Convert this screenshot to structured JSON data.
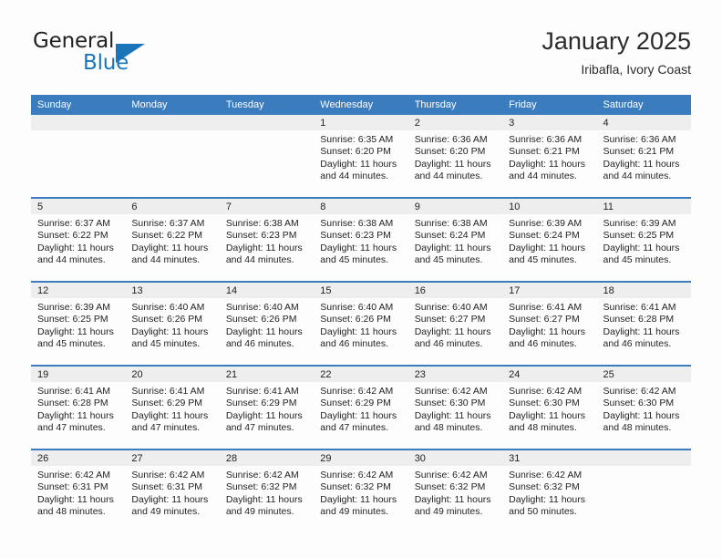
{
  "logo": {
    "word_top": "General",
    "word_bottom": "Blue",
    "triangle": "blue-triangle-icon",
    "color_dark": "#231f20",
    "color_blue": "#1b75bb"
  },
  "header": {
    "title": "January 2025",
    "subtitle": "Iribafla, Ivory Coast"
  },
  "theme": {
    "header_blue": "#3b7cbf",
    "daynum_band": "#eeeeee",
    "page_background": "#fdfdfd"
  },
  "weekday_headers": [
    "Sunday",
    "Monday",
    "Tuesday",
    "Wednesday",
    "Thursday",
    "Friday",
    "Saturday"
  ],
  "labels": {
    "sunrise_prefix": "Sunrise: ",
    "sunset_prefix": "Sunset: ",
    "daylight_prefix": "Daylight: "
  },
  "weeks": [
    [
      {
        "day": "",
        "sunrise": "",
        "sunset": "",
        "daylight_line1": "",
        "daylight_line2": ""
      },
      {
        "day": "",
        "sunrise": "",
        "sunset": "",
        "daylight_line1": "",
        "daylight_line2": ""
      },
      {
        "day": "",
        "sunrise": "",
        "sunset": "",
        "daylight_line1": "",
        "daylight_line2": ""
      },
      {
        "day": "1",
        "sunrise": "Sunrise: 6:35 AM",
        "sunset": "Sunset: 6:20 PM",
        "daylight_line1": "Daylight: 11 hours",
        "daylight_line2": "and 44 minutes."
      },
      {
        "day": "2",
        "sunrise": "Sunrise: 6:36 AM",
        "sunset": "Sunset: 6:20 PM",
        "daylight_line1": "Daylight: 11 hours",
        "daylight_line2": "and 44 minutes."
      },
      {
        "day": "3",
        "sunrise": "Sunrise: 6:36 AM",
        "sunset": "Sunset: 6:21 PM",
        "daylight_line1": "Daylight: 11 hours",
        "daylight_line2": "and 44 minutes."
      },
      {
        "day": "4",
        "sunrise": "Sunrise: 6:36 AM",
        "sunset": "Sunset: 6:21 PM",
        "daylight_line1": "Daylight: 11 hours",
        "daylight_line2": "and 44 minutes."
      }
    ],
    [
      {
        "day": "5",
        "sunrise": "Sunrise: 6:37 AM",
        "sunset": "Sunset: 6:22 PM",
        "daylight_line1": "Daylight: 11 hours",
        "daylight_line2": "and 44 minutes."
      },
      {
        "day": "6",
        "sunrise": "Sunrise: 6:37 AM",
        "sunset": "Sunset: 6:22 PM",
        "daylight_line1": "Daylight: 11 hours",
        "daylight_line2": "and 44 minutes."
      },
      {
        "day": "7",
        "sunrise": "Sunrise: 6:38 AM",
        "sunset": "Sunset: 6:23 PM",
        "daylight_line1": "Daylight: 11 hours",
        "daylight_line2": "and 44 minutes."
      },
      {
        "day": "8",
        "sunrise": "Sunrise: 6:38 AM",
        "sunset": "Sunset: 6:23 PM",
        "daylight_line1": "Daylight: 11 hours",
        "daylight_line2": "and 45 minutes."
      },
      {
        "day": "9",
        "sunrise": "Sunrise: 6:38 AM",
        "sunset": "Sunset: 6:24 PM",
        "daylight_line1": "Daylight: 11 hours",
        "daylight_line2": "and 45 minutes."
      },
      {
        "day": "10",
        "sunrise": "Sunrise: 6:39 AM",
        "sunset": "Sunset: 6:24 PM",
        "daylight_line1": "Daylight: 11 hours",
        "daylight_line2": "and 45 minutes."
      },
      {
        "day": "11",
        "sunrise": "Sunrise: 6:39 AM",
        "sunset": "Sunset: 6:25 PM",
        "daylight_line1": "Daylight: 11 hours",
        "daylight_line2": "and 45 minutes."
      }
    ],
    [
      {
        "day": "12",
        "sunrise": "Sunrise: 6:39 AM",
        "sunset": "Sunset: 6:25 PM",
        "daylight_line1": "Daylight: 11 hours",
        "daylight_line2": "and 45 minutes."
      },
      {
        "day": "13",
        "sunrise": "Sunrise: 6:40 AM",
        "sunset": "Sunset: 6:26 PM",
        "daylight_line1": "Daylight: 11 hours",
        "daylight_line2": "and 45 minutes."
      },
      {
        "day": "14",
        "sunrise": "Sunrise: 6:40 AM",
        "sunset": "Sunset: 6:26 PM",
        "daylight_line1": "Daylight: 11 hours",
        "daylight_line2": "and 46 minutes."
      },
      {
        "day": "15",
        "sunrise": "Sunrise: 6:40 AM",
        "sunset": "Sunset: 6:26 PM",
        "daylight_line1": "Daylight: 11 hours",
        "daylight_line2": "and 46 minutes."
      },
      {
        "day": "16",
        "sunrise": "Sunrise: 6:40 AM",
        "sunset": "Sunset: 6:27 PM",
        "daylight_line1": "Daylight: 11 hours",
        "daylight_line2": "and 46 minutes."
      },
      {
        "day": "17",
        "sunrise": "Sunrise: 6:41 AM",
        "sunset": "Sunset: 6:27 PM",
        "daylight_line1": "Daylight: 11 hours",
        "daylight_line2": "and 46 minutes."
      },
      {
        "day": "18",
        "sunrise": "Sunrise: 6:41 AM",
        "sunset": "Sunset: 6:28 PM",
        "daylight_line1": "Daylight: 11 hours",
        "daylight_line2": "and 46 minutes."
      }
    ],
    [
      {
        "day": "19",
        "sunrise": "Sunrise: 6:41 AM",
        "sunset": "Sunset: 6:28 PM",
        "daylight_line1": "Daylight: 11 hours",
        "daylight_line2": "and 47 minutes."
      },
      {
        "day": "20",
        "sunrise": "Sunrise: 6:41 AM",
        "sunset": "Sunset: 6:29 PM",
        "daylight_line1": "Daylight: 11 hours",
        "daylight_line2": "and 47 minutes."
      },
      {
        "day": "21",
        "sunrise": "Sunrise: 6:41 AM",
        "sunset": "Sunset: 6:29 PM",
        "daylight_line1": "Daylight: 11 hours",
        "daylight_line2": "and 47 minutes."
      },
      {
        "day": "22",
        "sunrise": "Sunrise: 6:42 AM",
        "sunset": "Sunset: 6:29 PM",
        "daylight_line1": "Daylight: 11 hours",
        "daylight_line2": "and 47 minutes."
      },
      {
        "day": "23",
        "sunrise": "Sunrise: 6:42 AM",
        "sunset": "Sunset: 6:30 PM",
        "daylight_line1": "Daylight: 11 hours",
        "daylight_line2": "and 48 minutes."
      },
      {
        "day": "24",
        "sunrise": "Sunrise: 6:42 AM",
        "sunset": "Sunset: 6:30 PM",
        "daylight_line1": "Daylight: 11 hours",
        "daylight_line2": "and 48 minutes."
      },
      {
        "day": "25",
        "sunrise": "Sunrise: 6:42 AM",
        "sunset": "Sunset: 6:30 PM",
        "daylight_line1": "Daylight: 11 hours",
        "daylight_line2": "and 48 minutes."
      }
    ],
    [
      {
        "day": "26",
        "sunrise": "Sunrise: 6:42 AM",
        "sunset": "Sunset: 6:31 PM",
        "daylight_line1": "Daylight: 11 hours",
        "daylight_line2": "and 48 minutes."
      },
      {
        "day": "27",
        "sunrise": "Sunrise: 6:42 AM",
        "sunset": "Sunset: 6:31 PM",
        "daylight_line1": "Daylight: 11 hours",
        "daylight_line2": "and 49 minutes."
      },
      {
        "day": "28",
        "sunrise": "Sunrise: 6:42 AM",
        "sunset": "Sunset: 6:32 PM",
        "daylight_line1": "Daylight: 11 hours",
        "daylight_line2": "and 49 minutes."
      },
      {
        "day": "29",
        "sunrise": "Sunrise: 6:42 AM",
        "sunset": "Sunset: 6:32 PM",
        "daylight_line1": "Daylight: 11 hours",
        "daylight_line2": "and 49 minutes."
      },
      {
        "day": "30",
        "sunrise": "Sunrise: 6:42 AM",
        "sunset": "Sunset: 6:32 PM",
        "daylight_line1": "Daylight: 11 hours",
        "daylight_line2": "and 49 minutes."
      },
      {
        "day": "31",
        "sunrise": "Sunrise: 6:42 AM",
        "sunset": "Sunset: 6:32 PM",
        "daylight_line1": "Daylight: 11 hours",
        "daylight_line2": "and 50 minutes."
      },
      {
        "day": "",
        "sunrise": "",
        "sunset": "",
        "daylight_line1": "",
        "daylight_line2": ""
      }
    ]
  ]
}
